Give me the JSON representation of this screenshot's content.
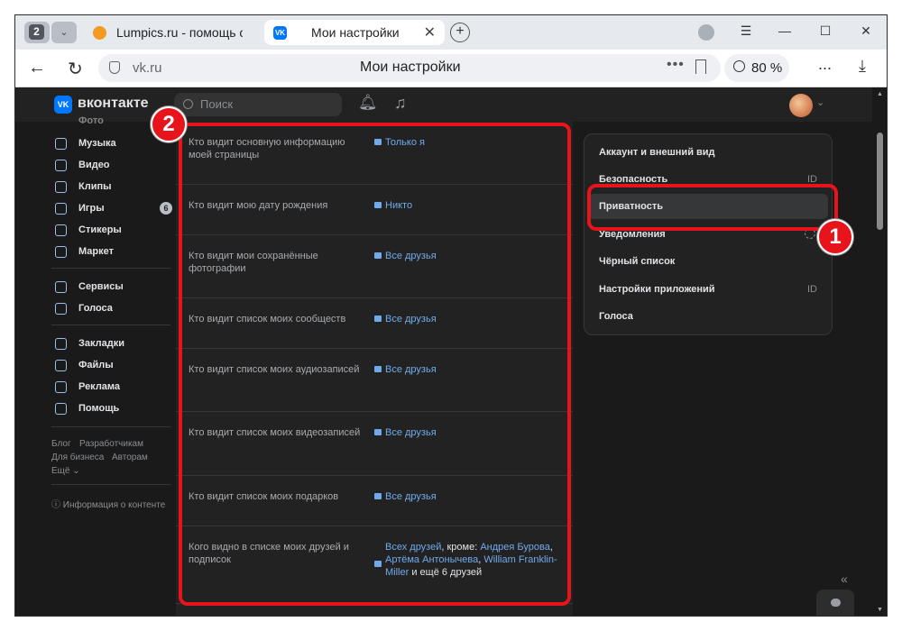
{
  "browser": {
    "tab_count": "2",
    "tabs": [
      {
        "label": "Lumpics.ru - помощь с ко"
      },
      {
        "label": "Мои настройки",
        "favicon": "VK"
      }
    ],
    "url": "vk.ru",
    "page_title": "Мои настройки",
    "zoom": "80 %",
    "menu_label": "..."
  },
  "vk": {
    "brand": "вконтакте",
    "logo": "VK",
    "search_placeholder": "Поиск"
  },
  "left_menu": {
    "cut_item": "Фото",
    "items": [
      {
        "label": "Музыка",
        "icon": "music-icon"
      },
      {
        "label": "Видео",
        "icon": "video-icon"
      },
      {
        "label": "Клипы",
        "icon": "clips-icon"
      },
      {
        "label": "Игры",
        "icon": "games-icon",
        "badge": "6"
      },
      {
        "label": "Стикеры",
        "icon": "stickers-icon"
      },
      {
        "label": "Маркет",
        "icon": "market-icon"
      },
      {
        "label": "Сервисы",
        "icon": "services-icon"
      },
      {
        "label": "Голоса",
        "icon": "votes-icon"
      },
      {
        "label": "Закладки",
        "icon": "bookmarks-icon"
      },
      {
        "label": "Файлы",
        "icon": "files-icon"
      },
      {
        "label": "Реклама",
        "icon": "ads-icon"
      },
      {
        "label": "Помощь",
        "icon": "help-icon"
      }
    ],
    "footer": {
      "blog": "Блог",
      "developers": "Разработчикам",
      "business": "Для бизнеса",
      "authors": "Авторам",
      "more": "Ещё ⌄",
      "content_info": "ⓘ Информация о контенте"
    }
  },
  "privacy": {
    "rows": [
      {
        "question": "Кто видит основную информацию моей страницы",
        "answer": "Только я"
      },
      {
        "question": "Кто видит мою дату рождения",
        "answer": "Никто"
      },
      {
        "question": "Кто видит мои сохранённые фотографии",
        "answer": "Все друзья"
      },
      {
        "question": "Кто видит список моих сообществ",
        "answer": "Все друзья"
      },
      {
        "question": "Кто видит список моих аудиозаписей",
        "answer": "Все друзья"
      },
      {
        "question": "Кто видит список моих видеозаписей",
        "answer": "Все друзья"
      },
      {
        "question": "Кто видит список моих подарков",
        "answer": "Все друзья"
      }
    ],
    "friends_row": {
      "question": "Кого видно в списке моих друзей и подписок",
      "part1": "Всех друзей",
      "part2": ", кроме: ",
      "part3": "Андрея Бурова",
      "part4": ", ",
      "part5": "Артёма Антонычева",
      "part6": ", ",
      "part7": "William Franklin-Miller",
      "part8": " и ещё 6 друзей"
    }
  },
  "settings_menu": {
    "items": [
      {
        "label": "Аккаунт и внешний вид"
      },
      {
        "label": "Безопасность",
        "tag": "ID"
      },
      {
        "label": "Приватность",
        "active": true
      },
      {
        "label": "Уведомления"
      },
      {
        "label": "Чёрный список"
      },
      {
        "label": "Настройки приложений",
        "tag": "ID"
      },
      {
        "label": "Голоса"
      }
    ]
  },
  "annotations": {
    "marker1": "1",
    "marker2": "2",
    "color": "#e8141c"
  },
  "colors": {
    "accent": "#0077ff",
    "link": "#71aaeb",
    "background": "#1a1a1a",
    "panel": "#222222"
  }
}
